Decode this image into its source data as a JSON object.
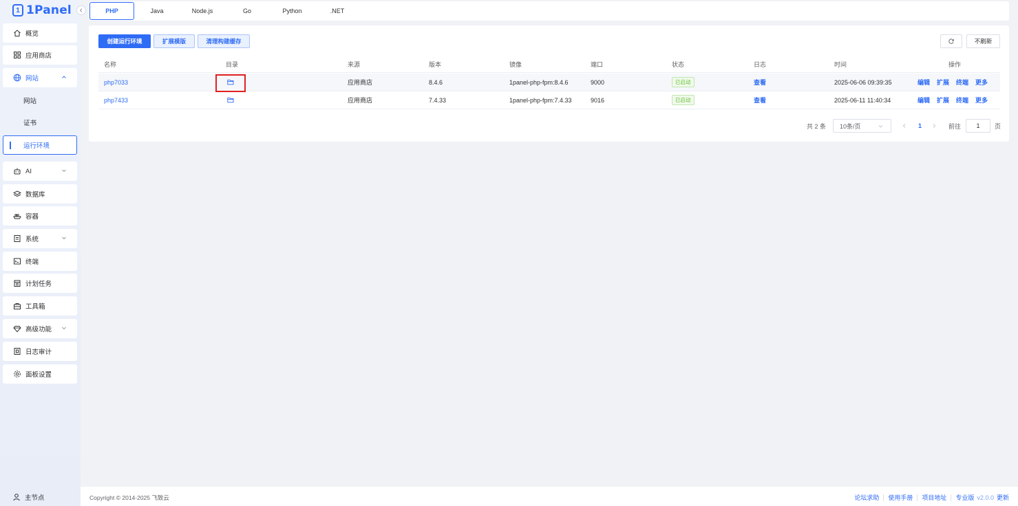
{
  "app": {
    "logo_text": "1Panel",
    "logo_mark": "1"
  },
  "sidebar": {
    "items": [
      {
        "label": "概览",
        "icon": "home-icon"
      },
      {
        "label": "应用商店",
        "icon": "grid-icon"
      },
      {
        "label": "网站",
        "icon": "globe-icon",
        "expanded": true
      },
      {
        "label": "AI",
        "icon": "robot-icon"
      },
      {
        "label": "数据库",
        "icon": "layers-icon"
      },
      {
        "label": "容器",
        "icon": "ship-icon"
      },
      {
        "label": "系统",
        "icon": "file-icon"
      },
      {
        "label": "终端",
        "icon": "terminal-icon"
      },
      {
        "label": "计划任务",
        "icon": "calendar-icon"
      },
      {
        "label": "工具箱",
        "icon": "toolbox-icon"
      },
      {
        "label": "高级功能",
        "icon": "diamond-icon"
      },
      {
        "label": "日志审计",
        "icon": "log-icon"
      },
      {
        "label": "面板设置",
        "icon": "gear-icon"
      }
    ],
    "sub_items": [
      {
        "label": "网站"
      },
      {
        "label": "证书"
      },
      {
        "label": "运行环境",
        "active": true
      }
    ],
    "node_label": "主节点"
  },
  "tabs": [
    "PHP",
    "Java",
    "Node.js",
    "Go",
    "Python",
    ".NET"
  ],
  "toolbar": {
    "create_label": "创建运行环境",
    "extensions_label": "扩展模版",
    "clear_cache_label": "清理构建缓存",
    "no_refresh_label": "不刷新"
  },
  "table": {
    "headers": [
      "名称",
      "目录",
      "来源",
      "版本",
      "镜像",
      "端口",
      "状态",
      "日志",
      "时间",
      "操作"
    ],
    "rows": [
      {
        "name": "php7033",
        "source": "应用商店",
        "version": "8.4.6",
        "image": "1panel-php-fpm:8.4.6",
        "port": "9000",
        "status": "已启动",
        "log": "查看",
        "time": "2025-06-06 09:39:35"
      },
      {
        "name": "php7433",
        "source": "应用商店",
        "version": "7.4.33",
        "image": "1panel-php-fpm:7.4.33",
        "port": "9016",
        "status": "已启动",
        "log": "查看",
        "time": "2025-06-11 11:40:34"
      }
    ],
    "actions": [
      "编辑",
      "扩展",
      "终端",
      "更多"
    ]
  },
  "pagination": {
    "total_label": "共 2 条",
    "page_size": "10条/页",
    "current_page": "1",
    "goto_prefix": "前往",
    "goto_value": "1",
    "goto_suffix": "页"
  },
  "footer": {
    "copyright": "Copyright © 2014-2025 飞致云",
    "forum": "论坛求助",
    "manual": "使用手册",
    "project": "项目地址",
    "edition": "专业版",
    "version": "v2.0.0",
    "update": "更新"
  },
  "colors": {
    "accent": "#2f6cf5",
    "success": "#67c23a",
    "highlight": "#e02020"
  }
}
